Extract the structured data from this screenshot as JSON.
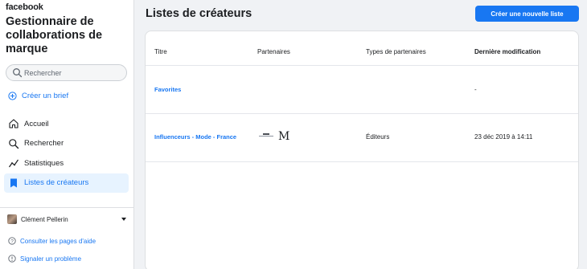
{
  "brand": "facebook",
  "app_title": "Gestionnaire de collaborations de marque",
  "search": {
    "placeholder": "Rechercher"
  },
  "brief": {
    "label": "Créer un brief"
  },
  "nav": {
    "items": [
      {
        "label": "Accueil",
        "icon": "home-icon"
      },
      {
        "label": "Rechercher",
        "icon": "search-icon"
      },
      {
        "label": "Statistiques",
        "icon": "chart-icon"
      },
      {
        "label": "Listes de créateurs",
        "icon": "bookmark-icon",
        "active": true
      }
    ]
  },
  "user": {
    "name": "Clément Pellerin"
  },
  "footer": {
    "help": "Consulter les pages d'aide",
    "report": "Signaler un problème"
  },
  "main": {
    "title": "Listes de créateurs",
    "create_button": "Créer une nouvelle liste"
  },
  "table": {
    "headers": [
      "Titre",
      "Partenaires",
      "Types de partenaires",
      "Dernière modification"
    ],
    "rows": [
      {
        "title": "Favorites",
        "partners": [],
        "types": "",
        "modified": "-"
      },
      {
        "title": "Influenceurs - Mode - France",
        "partners": [
          "partner-logo",
          "M"
        ],
        "types": "Éditeurs",
        "modified": "23 déc 2019 à 14:11"
      }
    ]
  },
  "colors": {
    "accent": "#1877f2",
    "background": "#f0f2f5",
    "active_bg": "#e7f3ff"
  }
}
